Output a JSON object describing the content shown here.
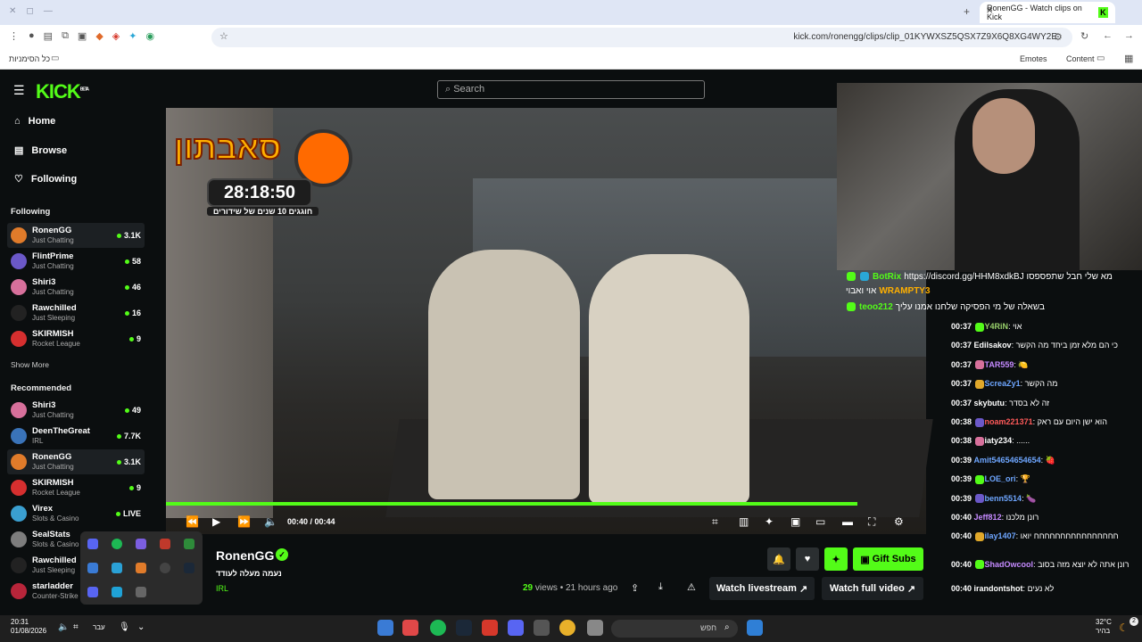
{
  "browser": {
    "tab_title": "RonenGG - Watch clips on Kick",
    "url": "kick.com/ronengg/clips/clip_01KYWXSZ5QSX7Z9X6Q8XG4WY2E",
    "bookmarks_label": "כל הסימניות",
    "emotes_label": "Emotes",
    "content_label": "Content"
  },
  "kick": {
    "logo": "KICK",
    "logo_beta": "BETA",
    "search_placeholder": "Search",
    "nav": [
      "Home",
      "Browse",
      "Following"
    ],
    "following_heading": "Following",
    "recommended_heading": "Recommended",
    "show_more": "Show More",
    "following": [
      {
        "name": "RonenGG",
        "category": "Just Chatting",
        "viewers": "3.1K",
        "color": "#e07b2a"
      },
      {
        "name": "FlintPrime",
        "category": "Just Chatting",
        "viewers": "58",
        "color": "#6b58c8"
      },
      {
        "name": "Shiri3",
        "category": "Just Chatting",
        "viewers": "46",
        "color": "#d7709b"
      },
      {
        "name": "Rawchilled",
        "category": "Just Sleeping",
        "viewers": "16",
        "color": "#222222"
      },
      {
        "name": "SKIRMISH",
        "category": "Rocket League",
        "viewers": "9",
        "color": "#d62f2f"
      }
    ],
    "recommended": [
      {
        "name": "Shiri3",
        "category": "Just Chatting",
        "viewers": "49",
        "color": "#d7709b"
      },
      {
        "name": "DeenTheGreat",
        "category": "IRL",
        "viewers": "7.7K",
        "color": "#3a73b8"
      },
      {
        "name": "RonenGG",
        "category": "Just Chatting",
        "viewers": "3.1K",
        "color": "#e07b2a"
      },
      {
        "name": "SKIRMISH",
        "category": "Rocket League",
        "viewers": "9",
        "color": "#d62f2f"
      },
      {
        "name": "Virex",
        "category": "Slots & Casino",
        "viewers": "LIVE",
        "color": "#3a9fd0"
      },
      {
        "name": "SealStats",
        "category": "Slots & Casino",
        "viewers": "",
        "color": "#7d7d7d"
      },
      {
        "name": "Rawchilled",
        "category": "Just Sleeping",
        "viewers": "",
        "color": "#222222"
      },
      {
        "name": "starladder",
        "category": "Counter-Strike",
        "viewers": "",
        "color": "#b8253a"
      }
    ]
  },
  "video": {
    "overlay_title": "סאבתון",
    "overlay_timer": "28:18:50",
    "overlay_subtitle": "חוגגים 10 שנים של שידורים",
    "current_time": "00:40",
    "duration": "00:44",
    "progress": 0.91
  },
  "clip": {
    "channel": "RonenGG",
    "title": "נעמה מעלה לעודד",
    "category": "IRL",
    "views": "29",
    "views_label": "views",
    "age": "21 hours ago",
    "gift_subs": "Gift Subs",
    "watch_livestream": "Watch livestream",
    "watch_full_video": "Watch full video"
  },
  "pinned": [
    {
      "user": "BotRix",
      "text": "https://discord.gg/HHM8xdkBJ מא שלי חבל שתפספסו",
      "color": "#53fc18"
    },
    {
      "user": "WRAMPTY3",
      "text": "אוי ואבוי ",
      "color": "#ffb000"
    },
    {
      "user": "teoo212",
      "text": "בשאלה של מי הפסיקה שלחנו אמנו עליך",
      "color": "#53fc18"
    }
  ],
  "chat": [
    {
      "time": "00:37",
      "user": "Y4RiN",
      "text": "אוי",
      "color": "#9ad26c"
    },
    {
      "time": "00:37",
      "user": "Edilsakov",
      "text": "כי הם מלא זמן ביחד מה הקשר",
      "color": "#ffffff"
    },
    {
      "time": "00:37",
      "user": "TAR559",
      "text": "🍋",
      "color": "#c58aff"
    },
    {
      "time": "00:37",
      "user": "ScreaZy1",
      "text": "מה הקשר",
      "color": "#6ea6ff"
    },
    {
      "time": "00:37",
      "user": "skybutu",
      "text": "זה לא בסדר",
      "color": "#ffffff"
    },
    {
      "time": "00:38",
      "user": "noam221371",
      "text": "הוא ישן היום עם ראק",
      "color": "#ff5a5a"
    },
    {
      "time": "00:38",
      "user": "iaty234",
      "text": "......",
      "color": "#ffffff"
    },
    {
      "time": "00:39",
      "user": "Amit54654654654",
      "text": "🍓",
      "color": "#6ea6ff"
    },
    {
      "time": "00:39",
      "user": "LOE_ori",
      "text": "🏆",
      "color": "#6ea6ff"
    },
    {
      "time": "00:39",
      "user": "benn5514",
      "text": "🍆",
      "color": "#6ea6ff"
    },
    {
      "time": "00:40",
      "user": "Jeff812",
      "text": "רונן מלכנו",
      "color": "#c58aff"
    },
    {
      "time": "00:40",
      "user": "ilay1407",
      "text": "חחחחחחחחחחחחחחחח יואו",
      "color": "#6ea6ff"
    },
    {
      "time": "00:40",
      "user": "ShadOwcool",
      "text": "רונן אתה לא יוצא מזה בסוב",
      "color": "#c58aff"
    },
    {
      "time": "00:40",
      "user": "irandontshot",
      "text": "לא נעים",
      "color": "#ffffff"
    }
  ],
  "taskbar": {
    "time": "20:31",
    "date": "01/08/2026",
    "lang": "עבר",
    "search_placeholder": "חפש",
    "weather_temp": "32°C",
    "weather_label": "בהיר",
    "notification_count": "2"
  },
  "accent": "#53fc18"
}
